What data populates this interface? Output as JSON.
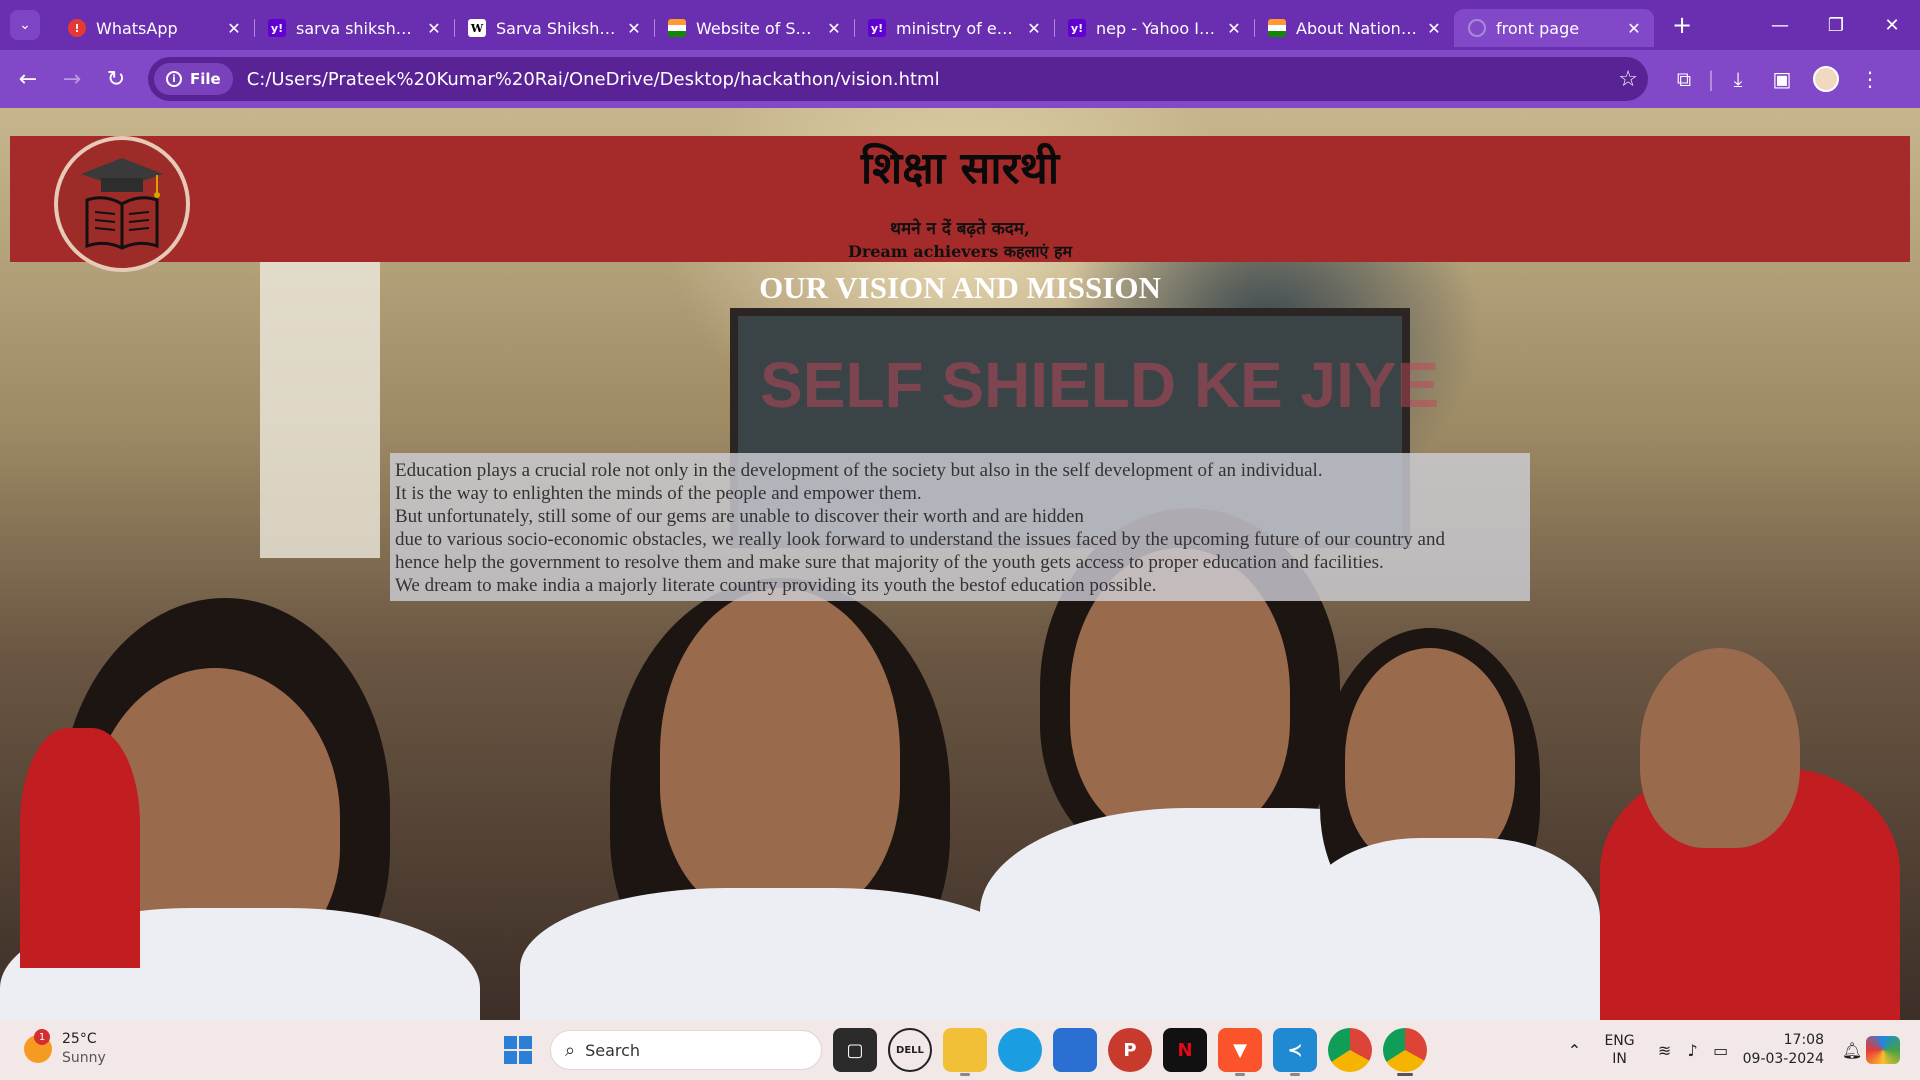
{
  "browser": {
    "tabs": [
      {
        "title": "WhatsApp",
        "favicon": "whatsapp-icon",
        "fav_class": "fav-wa",
        "fav_glyph": "!"
      },
      {
        "title": "sarva shiksha abhiyan",
        "favicon": "yahoo-icon",
        "fav_class": "fav-y",
        "fav_glyph": "y!"
      },
      {
        "title": "Sarva Shiksha Abhiyan",
        "favicon": "wikipedia-icon",
        "fav_class": "fav-w",
        "fav_glyph": "W"
      },
      {
        "title": "Website of Sarva",
        "favicon": "india-flag-icon",
        "fav_class": "fav-in",
        "fav_glyph": ""
      },
      {
        "title": "ministry of education",
        "favicon": "yahoo-icon",
        "fav_class": "fav-y",
        "fav_glyph": "y!"
      },
      {
        "title": "nep - Yahoo India",
        "favicon": "yahoo-icon",
        "fav_class": "fav-y",
        "fav_glyph": "y!"
      },
      {
        "title": "About National Education",
        "favicon": "india-flag-icon",
        "fav_class": "fav-in",
        "fav_glyph": ""
      },
      {
        "title": "front page",
        "favicon": "globe-icon",
        "fav_class": "fav-glb",
        "fav_glyph": "",
        "active": true
      }
    ],
    "site_chip": "File",
    "url": "C:/Users/Prateek%20Kumar%20Rai/OneDrive/Desktop/hackathon/vision.html",
    "accent": "#6a2fb0"
  },
  "page": {
    "title": "शिक्षा सारथी",
    "tagline_line1": "थमने न दें बढ़ते कदम,",
    "tagline_line2": "Dream achievers कहलाएं हम",
    "section_title": "OUR VISION AND MISSION",
    "vision_lines": [
      "Education plays a crucial role not only in the development of the society but also in the self development of an individual.",
      "It is the way to enlighten the minds of the people and empower them.",
      "But unfortunately, still some of our gems are unable to discover their worth and are hidden",
      "due to various socio-economic obstacles, we really look forward to understand the issues faced by the upcoming future of our country and",
      "hence help the government to resolve them and make sure that majority of the youth gets access to proper education and facilities.",
      "We dream to make india a majorly literate country providing its youth the bestof education possible."
    ],
    "header_color": "#a52a2a",
    "board_text": "SELF SHIELD KE JIYE"
  },
  "taskbar": {
    "weather_temp": "25°C",
    "weather_desc": "Sunny",
    "weather_badge": "1",
    "search_label": "Search",
    "lang_top": "ENG",
    "lang_bottom": "IN",
    "time": "17:08",
    "date": "09-03-2024"
  }
}
